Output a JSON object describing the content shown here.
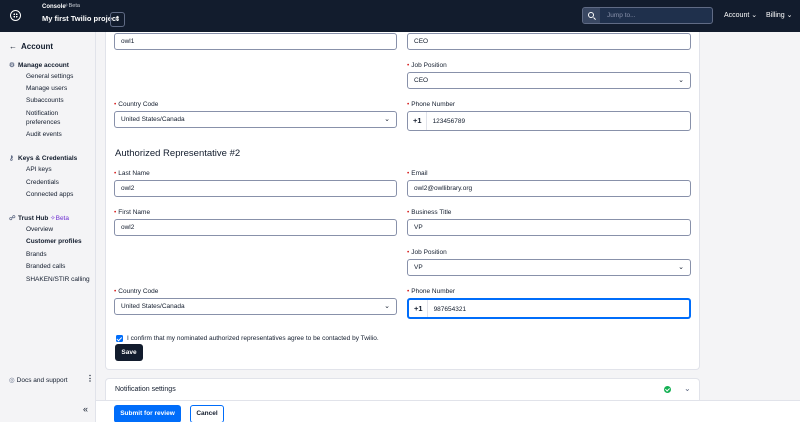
{
  "topbar": {
    "console_label": "Console",
    "beta_label": "Beta",
    "project_name": "My first Twilio project",
    "switch_glyph": "⇕",
    "search_placeholder": "Jump to...",
    "account_menu": "Account ⌄",
    "billing_menu": "Billing ⌄"
  },
  "sidebar": {
    "back_label": "Account",
    "manage_account": {
      "heading": "Manage account",
      "icon": "gear-icon",
      "items": [
        "General settings",
        "Manage users",
        "Subaccounts",
        "Notification",
        "preferences",
        "Audit events"
      ]
    },
    "keys": {
      "heading": "Keys & Credentials",
      "icon": "key-icon",
      "items": [
        "API keys",
        "Credentials",
        "Connected apps"
      ]
    },
    "trust_hub": {
      "heading": "Trust Hub",
      "beta": "Beta",
      "icon": "trust-hub-icon",
      "items": [
        "Overview",
        "Customer profiles",
        "Brands",
        "Branded calls",
        "SHAKEN/STIR calling"
      ]
    },
    "docs_support": "Docs and support",
    "more_glyph": "⋮",
    "collapse_glyph": "«"
  },
  "form": {
    "rep1": {
      "last_name_value": "owl1",
      "business_title_value": "CEO",
      "job_position_label": "Job Position",
      "job_position_value": "CEO",
      "country_code_label": "Country Code",
      "country_code_value": "United States/Canada",
      "phone_label": "Phone Number",
      "phone_prefix": "+1",
      "phone_value": "123456789"
    },
    "rep2": {
      "section_title": "Authorized Representative #2",
      "last_name_label": "Last Name",
      "last_name_value": "owl2",
      "email_label": "Email",
      "email_value": "owl2@owllibrary.org",
      "first_name_label": "First Name",
      "first_name_value": "owl2",
      "business_title_label": "Business Title",
      "business_title_value": "VP",
      "job_position_label": "Job Position",
      "job_position_value": "VP",
      "country_code_label": "Country Code",
      "country_code_value": "United States/Canada",
      "phone_label": "Phone Number",
      "phone_prefix": "+1",
      "phone_value": "987654321"
    },
    "required_marker": "•",
    "select_chevron": "⌄",
    "confirm_text": "I confirm that my nominated authorized representatives agree to be contacted by Twilio.",
    "save_label": "Save"
  },
  "notification": {
    "title": "Notification settings",
    "status_color": "#14b053",
    "chevron": "⌄"
  },
  "footer": {
    "submit_label": "Submit for review",
    "cancel_label": "Cancel"
  },
  "colors": {
    "topbar_bg": "#121c2d",
    "primary": "#006dfa",
    "required": "#d61f1f"
  }
}
